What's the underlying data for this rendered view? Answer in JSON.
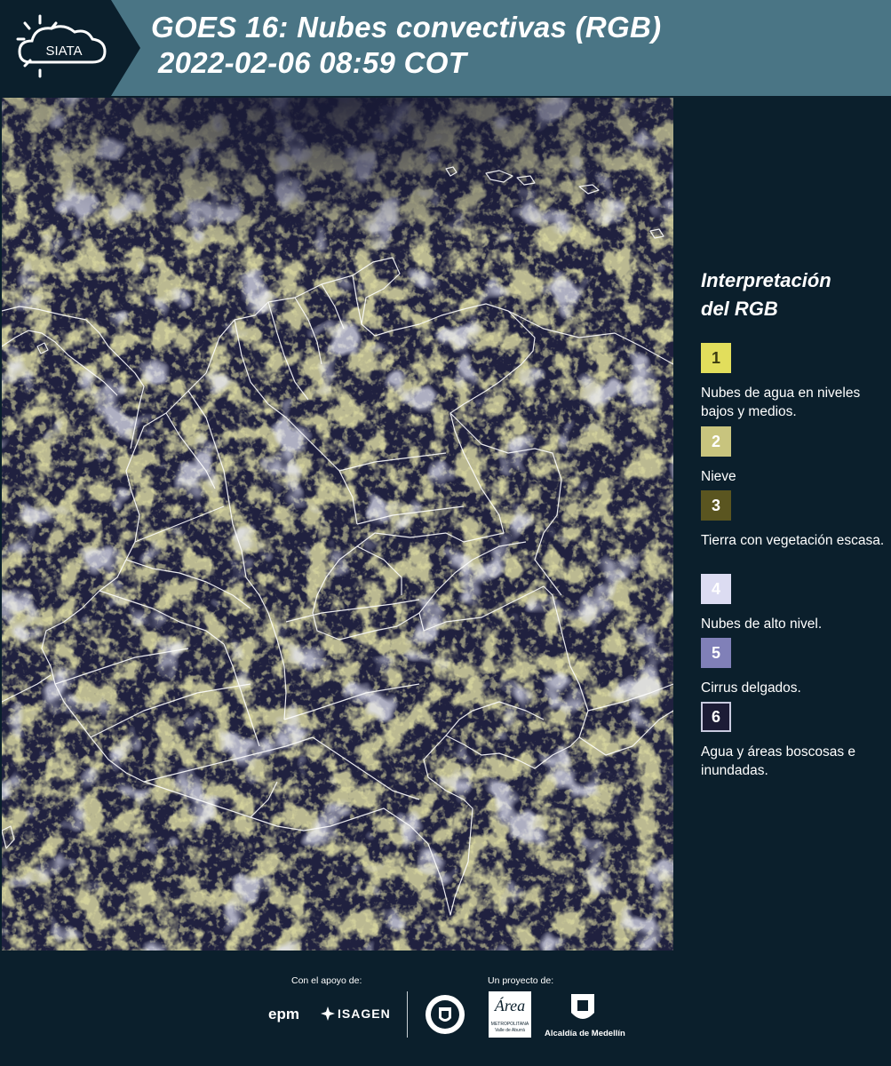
{
  "header": {
    "logo_text": "SIATA",
    "title_line1": "GOES 16: Nubes convectivas (RGB)",
    "title_line2": "2022-02-06 08:59 COT"
  },
  "legend": {
    "title_line1": "Interpretación",
    "title_line2": "del RGB",
    "items": [
      {
        "number": "1",
        "label": "Nubes de agua en niveles bajos y medios.",
        "color": "#e2de5c",
        "text_color": "#3b3b10"
      },
      {
        "number": "2",
        "label": "Nieve",
        "color": "#c8c47e",
        "text_color": "#ffffff"
      },
      {
        "number": "3",
        "label": "Tierra con vegetación escasa.",
        "color": "#5a5520",
        "text_color": "#ffffff"
      },
      {
        "number": "4",
        "label": "Nubes de alto nivel.",
        "color": "#dcdcf2",
        "text_color": "#ffffff"
      },
      {
        "number": "5",
        "label": "Cirrus delgados.",
        "color": "#8080b8",
        "text_color": "#ffffff"
      },
      {
        "number": "6",
        "label": "Agua y áreas boscosas e inundadas.",
        "color": "#1c1c36",
        "text_color": "#ffffff"
      }
    ]
  },
  "footer": {
    "support_label": "Con el apoyo de:",
    "project_label": "Un proyecto de:",
    "sponsors": [
      "epm",
      "ISAGEN"
    ],
    "partners": [
      "Área Metropolitana Valle de Aburrá",
      "Alcaldía de Medellín"
    ],
    "area_logo_text": "Área",
    "area_sub1": "METROPOLITANA",
    "area_sub2": "Valle de Aburrá",
    "alcaldia_text": "Alcaldía de Medellín"
  },
  "map": {
    "background_color": "#20213f",
    "cloud_low_color": "#d8d36a",
    "cloud_high_color": "#cdd0ee",
    "border_color": "#ffffff"
  }
}
